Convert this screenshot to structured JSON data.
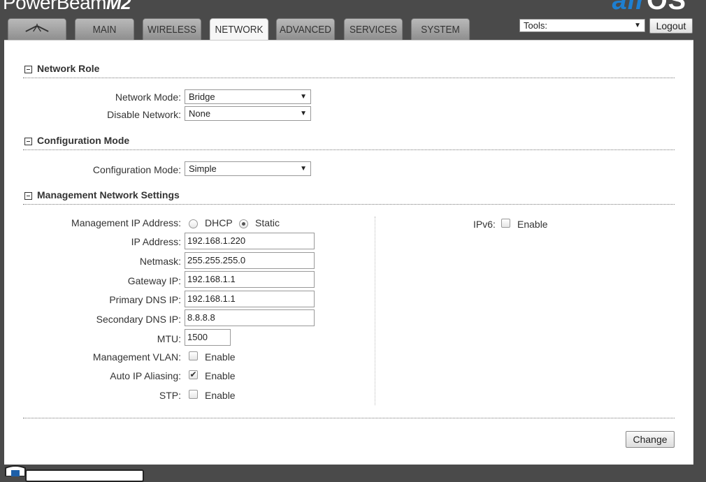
{
  "header": {
    "brand_name": "PowerBeam",
    "brand_model": "M2",
    "airos_air": "air",
    "airos_os": "OS",
    "tabs": [
      {
        "label": ""
      },
      {
        "label": "MAIN"
      },
      {
        "label": "WIRELESS"
      },
      {
        "label": "NETWORK"
      },
      {
        "label": "ADVANCED"
      },
      {
        "label": "SERVICES"
      },
      {
        "label": "SYSTEM"
      }
    ],
    "active_tab": "NETWORK",
    "tools_value": "Tools:",
    "logout_label": "Logout"
  },
  "network_role": {
    "title": "Network Role",
    "network_mode_label": "Network Mode:",
    "network_mode_value": "Bridge",
    "disable_network_label": "Disable Network:",
    "disable_network_value": "None"
  },
  "configuration_mode": {
    "title": "Configuration Mode",
    "label": "Configuration Mode:",
    "value": "Simple"
  },
  "management": {
    "title": "Management Network Settings",
    "ip_mode_label": "Management IP Address:",
    "dhcp_label": "DHCP",
    "static_label": "Static",
    "ip_mode_selected": "Static",
    "ip_address_label": "IP Address:",
    "ip_address_value": "192.168.1.220",
    "netmask_label": "Netmask:",
    "netmask_value": "255.255.255.0",
    "gateway_label": "Gateway IP:",
    "gateway_value": "192.168.1.1",
    "primary_dns_label": "Primary DNS IP:",
    "primary_dns_value": "192.168.1.1",
    "secondary_dns_label": "Secondary DNS IP:",
    "secondary_dns_value": "8.8.8.8",
    "mtu_label": "MTU:",
    "mtu_value": "1500",
    "vlan_label": "Management VLAN:",
    "vlan_enable_label": "Enable",
    "vlan_checked": false,
    "auto_ip_label": "Auto IP Aliasing:",
    "auto_ip_enable_label": "Enable",
    "auto_ip_checked": true,
    "stp_label": "STP:",
    "stp_enable_label": "Enable",
    "stp_checked": false,
    "ipv6_label": "IPv6:",
    "ipv6_enable_label": "Enable",
    "ipv6_checked": false
  },
  "actions": {
    "change_label": "Change"
  },
  "colors": {
    "background": "#4a4a4a",
    "airos_blue": "#1d7fd1",
    "panel": "#ffffff"
  }
}
